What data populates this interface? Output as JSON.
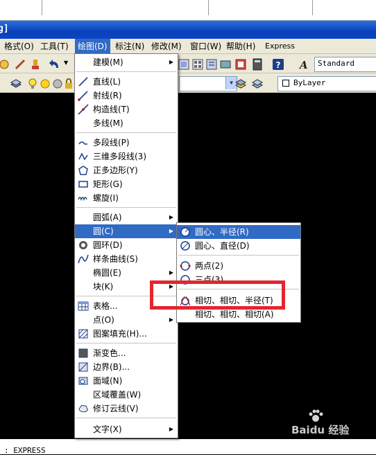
{
  "window": {
    "title_fragment": "g]"
  },
  "menubar": {
    "items": [
      {
        "label": "格式(O)"
      },
      {
        "label": "工具(T)"
      },
      {
        "label": "绘图(D)"
      },
      {
        "label": "标注(N)"
      },
      {
        "label": "修改(M)"
      },
      {
        "label": "窗口(W)"
      },
      {
        "label": "帮助(H)"
      },
      {
        "label": "Express"
      }
    ]
  },
  "toolbar": {
    "text_style": "Standard",
    "linetype": "ByLayer"
  },
  "draw_menu": {
    "items": [
      {
        "label": "建模(M)",
        "icon": "none"
      },
      {
        "label": "直线(L)",
        "icon": "line-icon"
      },
      {
        "label": "射线(R)",
        "icon": "ray-icon"
      },
      {
        "label": "构造线(T)",
        "icon": "xline-icon"
      },
      {
        "label": "多线(M)",
        "icon": "none"
      },
      {
        "label": "多段线(P)",
        "icon": "polyline-icon"
      },
      {
        "label": "三维多段线(3)",
        "icon": "3d-polyline-icon"
      },
      {
        "label": "正多边形(Y)",
        "icon": "polygon-icon"
      },
      {
        "label": "矩形(G)",
        "icon": "rectangle-icon"
      },
      {
        "label": "螺旋(I)",
        "icon": "helix-icon"
      },
      {
        "label": "圆弧(A)",
        "icon": "none"
      },
      {
        "label": "圆(C)",
        "icon": "none"
      },
      {
        "label": "圆环(D)",
        "icon": "donut-icon"
      },
      {
        "label": "样条曲线(S)",
        "icon": "spline-icon"
      },
      {
        "label": "椭圆(E)",
        "icon": "none"
      },
      {
        "label": "块(K)",
        "icon": "none"
      },
      {
        "label": "表格...",
        "icon": "table-icon"
      },
      {
        "label": "点(O)",
        "icon": "none"
      },
      {
        "label": "图案填充(H)...",
        "icon": "hatch-icon"
      },
      {
        "label": "渐变色...",
        "icon": "gradient-icon"
      },
      {
        "label": "边界(B)...",
        "icon": "boundary-icon"
      },
      {
        "label": "面域(N)",
        "icon": "region-icon"
      },
      {
        "label": "区域覆盖(W)",
        "icon": "none"
      },
      {
        "label": "修订云线(V)",
        "icon": "revcloud-icon"
      },
      {
        "label": "文字(X)",
        "icon": "none"
      }
    ]
  },
  "circle_submenu": {
    "items": [
      {
        "label": "圆心、半径(R)"
      },
      {
        "label": "圆心、直径(D)"
      },
      {
        "label": "两点(2)"
      },
      {
        "label": "三点(3)"
      },
      {
        "label": "相切、相切、半径(T)"
      },
      {
        "label": "相切、相切、相切(A)"
      }
    ]
  },
  "command_line": {
    "text": ": EXPRESS"
  },
  "watermark": {
    "text": "Baidu 经验"
  },
  "colors": {
    "menu_highlight": "#316ac5",
    "callout": "#e3262f",
    "titlebar": "#0a3fb8"
  }
}
